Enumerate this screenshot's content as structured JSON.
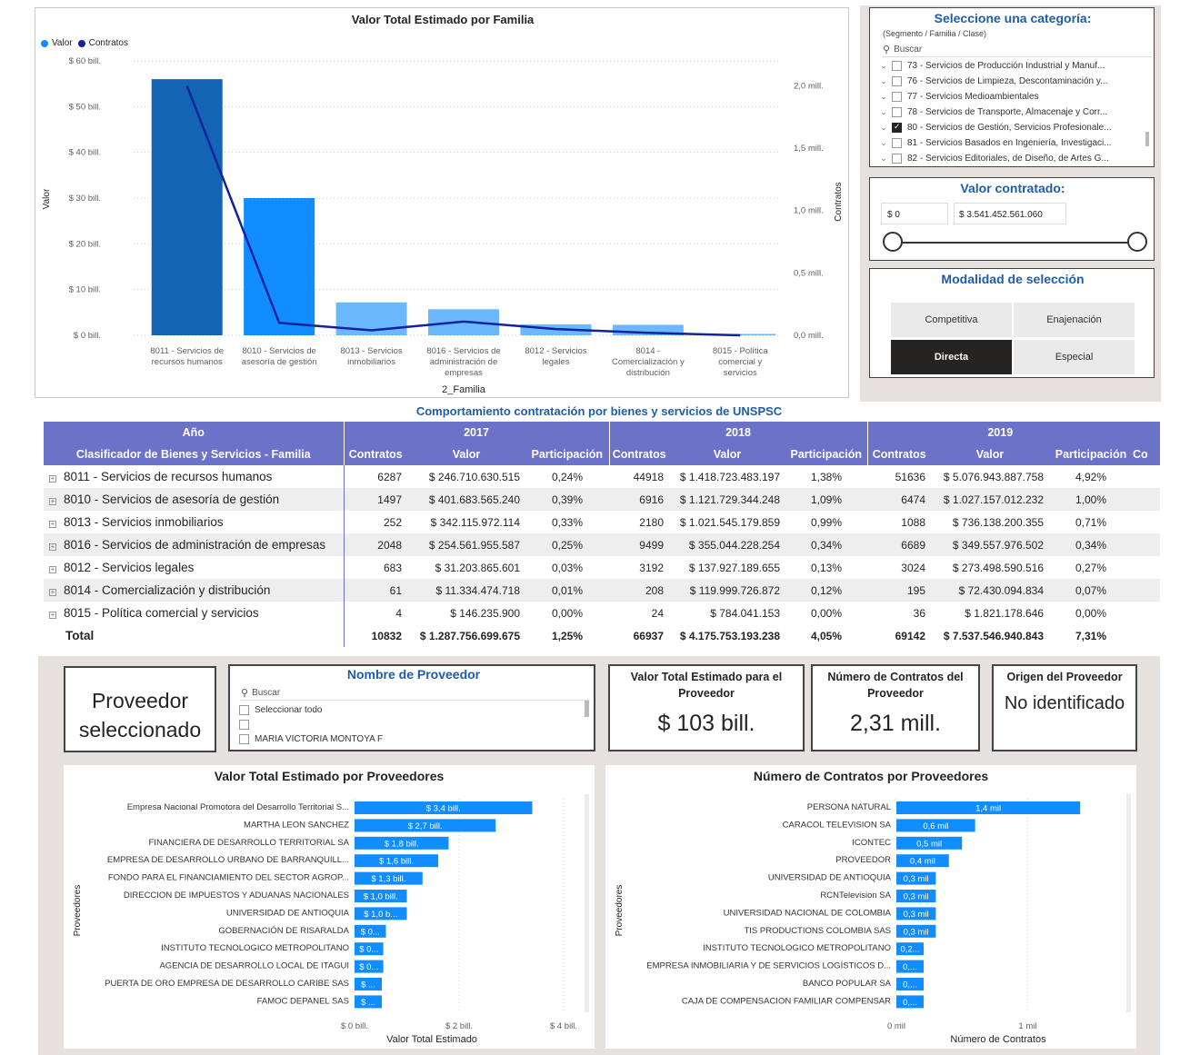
{
  "family_chart": {
    "title": "Valor Total Estimado por Familia",
    "legend": [
      {
        "name": "Valor",
        "color": "#118dff"
      },
      {
        "name": "Contratos",
        "color": "#12239e"
      }
    ],
    "y_left_ticks": [
      "$ 60 bill.",
      "$ 50 bill.",
      "$ 40 bill.",
      "$ 30 bill.",
      "$ 20 bill.",
      "$ 10 bill.",
      "$ 0 bill."
    ],
    "y_right_ticks": [
      "2,0 mill.",
      "1,5 mill.",
      "1,0 mill.",
      "0,5 mill.",
      "0,0 mill."
    ],
    "ylabel": "Valor",
    "y2label": "Contratos",
    "xlabel": "2_Familia",
    "categories": [
      [
        "8011 - Servicios de",
        "recursos humanos"
      ],
      [
        "8010 - Servicios de",
        "asesoría de gestión"
      ],
      [
        "8013 - Servicios",
        "inmobiliarios"
      ],
      [
        "8016 - Servicios de",
        "administración de",
        "empresas"
      ],
      [
        "8012 - Servicios",
        "legales"
      ],
      [
        "8014 -",
        "Comercialización y",
        "distribución"
      ],
      [
        "8015 - Política",
        "comercial y",
        "servicios"
      ]
    ]
  },
  "chart_data": [
    {
      "type": "bar",
      "title": "Valor Total Estimado por Familia",
      "xlabel": "2_Familia",
      "ylabel": "Valor",
      "y2label": "Contratos",
      "categories": [
        "8011 - Servicios de recursos humanos",
        "8010 - Servicios de asesoría de gestión",
        "8013 - Servicios inmobiliarios",
        "8016 - Servicios de administración de empresas",
        "8012 - Servicios legales",
        "8014 - Comercialización y distribución",
        "8015 - Política comercial y servicios"
      ],
      "series": [
        {
          "name": "Valor",
          "axis": "left",
          "unit": "bill.",
          "values": [
            56,
            30,
            7.2,
            5.7,
            2.4,
            2.3,
            0.3
          ],
          "color": "#118dff",
          "highlight_index": 0,
          "highlight_color": "#1464b4"
        },
        {
          "name": "Contratos",
          "axis": "right",
          "type": "line",
          "unit": "mill.",
          "values": [
            2.0,
            0.1,
            0.04,
            0.11,
            0.05,
            0.02,
            0.0
          ],
          "color": "#12239e"
        }
      ],
      "ylim": [
        0,
        60
      ],
      "y2lim": [
        0,
        2.2
      ]
    },
    {
      "type": "bar",
      "orientation": "horizontal",
      "title": "Valor Total Estimado por Proveedores",
      "xlabel": "Valor Total Estimado",
      "ylabel": "Proveedores",
      "categories": [
        "Empresa Nacional Promotora del Desarrollo Territorial S...",
        "MARTHA LEON SANCHEZ",
        "FINANCIERA DE DESARROLLO TERRITORIAL SA",
        "EMPRESA DE DESARROLLO URBANO DE BARRANQUILL...",
        "FONDO PARA EL FINANCIAMIENTO DEL SECTOR AGROP...",
        "DIRECCION DE IMPUESTOS Y ADUANAS NACIONALES",
        "UNIVERSIDAD DE ANTIOQUIA",
        "GOBERNACIÓN DE RISARALDA",
        "INSTITUTO TECNOLOGICO METROPOLITANO",
        "AGENCIA DE DESARROLLO LOCAL DE ITAGUI",
        "PUERTA DE ORO EMPRESA DE DESARROLLO CARIBE SAS",
        "FAMOC DEPANEL SAS"
      ],
      "values": [
        3.4,
        2.7,
        1.8,
        1.6,
        1.3,
        1.0,
        1.0,
        0.6,
        0.55,
        0.55,
        0.5,
        0.5
      ],
      "labels": [
        "$ 3,4 bill.",
        "$ 2,7 bill.",
        "$ 1,8 bill.",
        "$ 1,6 bill.",
        "$ 1,3 bill.",
        "$ 1,0 bill.",
        "$ 1,0 b...",
        "$ 0...",
        "$ 0...",
        "$ 0...",
        "$ ...",
        "$ ..."
      ],
      "xticks": [
        "$ 0 bill.",
        "$ 2 bill.",
        "$ 4 bill."
      ],
      "xlim": [
        0,
        4
      ]
    },
    {
      "type": "bar",
      "orientation": "horizontal",
      "title": "Número de Contratos por Proveedores",
      "xlabel": "Número de Contratos",
      "ylabel": "Proveedores",
      "categories": [
        "PERSONA NATURAL",
        "CARACOL TELEVISION SA",
        "ICONTEC",
        "PROVEEDOR",
        "UNIVERSIDAD DE ANTIOQUIA",
        "RCNTelevision SA",
        "UNIVERSIDAD NACIONAL DE COLOMBIA",
        "TIS PRODUCTIONS COLOMBIA SAS",
        "INSTITUTO TECNOLOGICO METROPOLITANO",
        "EMPRESA INMOBILIARIA Y DE SERVICIOS LOGÍSTICOS D...",
        "BANCO POPULAR SA",
        "CAJA DE COMPENSACION FAMILIAR COMPENSAR"
      ],
      "values": [
        1.4,
        0.6,
        0.5,
        0.4,
        0.3,
        0.3,
        0.3,
        0.3,
        0.2,
        0.18,
        0.18,
        0.18
      ],
      "labels": [
        "1,4 mil",
        "0,6 mil",
        "0,5 mil",
        "0,4 mil",
        "0,3 mil",
        "0,3 mil",
        "0,3 mil",
        "0,3 mil",
        "0,2...",
        "0,...",
        "0,...",
        "0,..."
      ],
      "xticks": [
        "0 mil",
        "1 mil"
      ],
      "xlim": [
        0,
        1.8
      ]
    }
  ],
  "category_slicer": {
    "title": "Seleccione una categoría:",
    "subtitle": "(Segmento / Familia / Clase)",
    "search_placeholder": "Buscar",
    "items": [
      {
        "label": "73 - Servicios de Producción Industrial y Manuf...",
        "checked": false
      },
      {
        "label": "76 - Servicios de Limpieza, Descontaminación y...",
        "checked": false
      },
      {
        "label": "77 - Servicios Medioambientales",
        "checked": false
      },
      {
        "label": "78 - Servicios de Transporte, Almacenaje y Corr...",
        "checked": false
      },
      {
        "label": "80 - Servicios de Gestión, Servicios Profesionale...",
        "checked": true
      },
      {
        "label": "81 - Servicios Basados en Ingeniería, Investigaci...",
        "checked": false
      },
      {
        "label": "82 - Servicios Editoriales, de Diseño, de Artes G...",
        "checked": false
      }
    ]
  },
  "value_slicer": {
    "title": "Valor contratado:",
    "min": "$ 0",
    "max": "$ 3.541.452.561.060"
  },
  "modalidad": {
    "title": "Modalidad de selección",
    "buttons": [
      {
        "label": "Competitiva",
        "selected": false
      },
      {
        "label": "Enajenación",
        "selected": false
      },
      {
        "label": "Directa",
        "selected": true
      },
      {
        "label": "Especial",
        "selected": false
      }
    ]
  },
  "matrix": {
    "title": "Comportamiento contratación por bienes y servicios de UNSPSC",
    "year_header": "Año",
    "row_header": "Clasificador de Bienes y Servicios - Familia",
    "years": [
      "2017",
      "2018",
      "2019"
    ],
    "col_headers": [
      "Contratos",
      "Valor",
      "Participación"
    ],
    "cut_header": "Co",
    "rows": [
      {
        "name": "8011 - Servicios de recursos humanos",
        "v": [
          "6287",
          "$ 246.710.630.515",
          "0,24%",
          "44918",
          "$ 1.418.723.483.197",
          "1,38%",
          "51636",
          "$ 5.076.943.887.758",
          "4,92%"
        ]
      },
      {
        "name": "8010 - Servicios de asesoría de gestión",
        "v": [
          "1497",
          "$ 401.683.565.240",
          "0,39%",
          "6916",
          "$ 1.121.729.344.248",
          "1,09%",
          "6474",
          "$ 1.027.157.012.232",
          "1,00%"
        ]
      },
      {
        "name": "8013 - Servicios inmobiliarios",
        "v": [
          "252",
          "$ 342.115.972.114",
          "0,33%",
          "2180",
          "$ 1.021.545.179.859",
          "0,99%",
          "1088",
          "$ 736.138.200.355",
          "0,71%"
        ]
      },
      {
        "name": "8016 - Servicios de administración de empresas",
        "v": [
          "2048",
          "$ 254.561.955.587",
          "0,25%",
          "9499",
          "$ 355.044.228.254",
          "0,34%",
          "6689",
          "$ 349.557.976.502",
          "0,34%"
        ]
      },
      {
        "name": "8012 - Servicios legales",
        "v": [
          "683",
          "$ 31.203.865.601",
          "0,03%",
          "3192",
          "$ 137.927.189.655",
          "0,13%",
          "3024",
          "$ 273.498.590.516",
          "0,27%"
        ]
      },
      {
        "name": "8014 - Comercialización y distribución",
        "v": [
          "61",
          "$ 11.334.474.718",
          "0,01%",
          "208",
          "$ 119.999.726.872",
          "0,12%",
          "195",
          "$ 72.430.094.834",
          "0,07%"
        ]
      },
      {
        "name": "8015 - Política comercial y servicios",
        "v": [
          "4",
          "$ 146.235.900",
          "0,00%",
          "24",
          "$ 784.041.153",
          "0,00%",
          "36",
          "$ 1.821.178.646",
          "0,00%"
        ]
      }
    ],
    "total": {
      "name": "Total",
      "v": [
        "10832",
        "$ 1.287.756.699.675",
        "1,25%",
        "66937",
        "$ 4.175.753.193.238",
        "4,05%",
        "69142",
        "$ 7.537.546.940.843",
        "7,31%"
      ]
    }
  },
  "provider_selected": {
    "line1": "Proveedor",
    "line2": "seleccionado"
  },
  "provider_slicer": {
    "title": "Nombre de Proveedor",
    "search_placeholder": "Buscar",
    "items": [
      "Seleccionar todo",
      "",
      "MARIA VICTORIA MONTOYA F"
    ]
  },
  "cards": [
    {
      "title": "Valor Total Estimado para el Proveedor",
      "value": "$ 103 bill."
    },
    {
      "title": "Número de Contratos del Proveedor",
      "value": "2,31 mill."
    },
    {
      "title": "Origen del Proveedor",
      "value": "No identificado"
    }
  ],
  "colors": {
    "header": "#6b72c8",
    "bar": "#118dff",
    "bar_dark": "#1464b4",
    "line": "#12239e",
    "bg_panel": "#e6e1de",
    "title_blue": "#1f5da8"
  }
}
